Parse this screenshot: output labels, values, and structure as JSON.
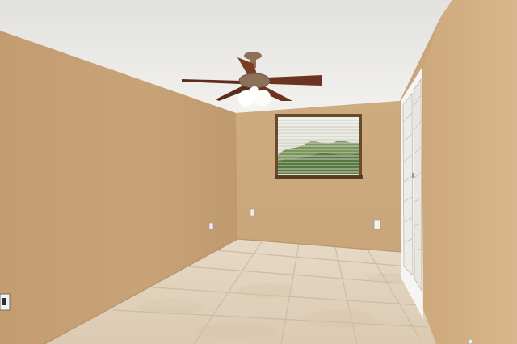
{
  "scene": {
    "subject": "empty-bedroom",
    "colors": {
      "wall_left": "#c7a277",
      "wall_back": "#cfab80",
      "wall_right": "#d2ae82",
      "ceiling": "#ecebe8",
      "floor": "#e2d3bf",
      "grout": "#c9b8a1",
      "fan_blade": "#6b3420",
      "fan_metal": "#8d7058",
      "blind": "#e9e6df",
      "window_frame": "#6a4a2c",
      "greenery": "#6e8f4f",
      "closet": "#f1efea"
    }
  }
}
